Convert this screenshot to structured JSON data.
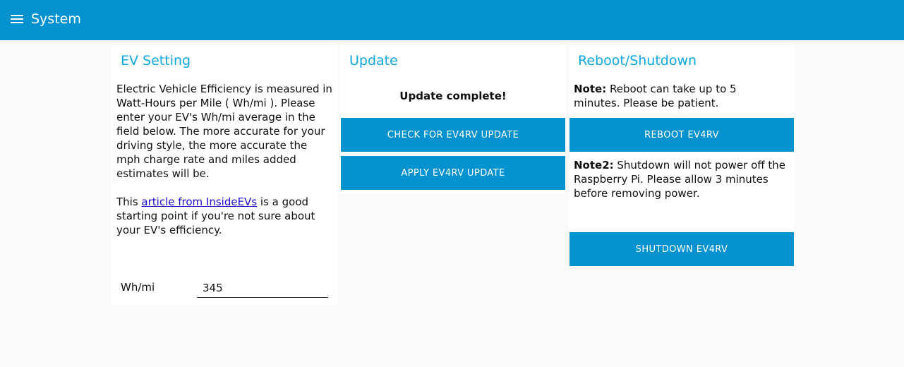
{
  "appbar": {
    "title": "System",
    "menu_icon": "hamburger-menu-icon"
  },
  "ev_setting": {
    "title": "EV Setting",
    "description": "Electric Vehicle Efficiency is measured in Watt-Hours per Mile ( Wh/mi ). Please enter your EV's Wh/mi average in the field below. The more accurate for your driving style, the more accurate the mph charge rate and miles added estimates will be.",
    "article_prefix": "This ",
    "article_link": "article from InsideEVs",
    "article_suffix": " is a good starting point if you're not sure about your EV's efficiency.",
    "field_label": "Wh/mi",
    "field_value": "345"
  },
  "update": {
    "title": "Update",
    "status": "Update complete!",
    "check_button": "CHECK FOR EV4RV UPDATE",
    "apply_button": "APPLY EV4RV UPDATE"
  },
  "reboot": {
    "title": "Reboot/Shutdown",
    "note1_label": "Note:",
    "note1_text": " Reboot can take up to 5 minutes. Please be patient.",
    "reboot_button": "REBOOT EV4RV",
    "note2_label": "Note2:",
    "note2_text": " Shutdown will not power off the Raspberry Pi. Please allow 3 minutes before removing power.",
    "shutdown_button": "SHUTDOWN EV4RV"
  },
  "colors": {
    "appbar": "#0292cf",
    "card_title": "#0ea7e0",
    "button": "#0292cf",
    "background": "#fafafa",
    "link": "#1a0dcc"
  }
}
